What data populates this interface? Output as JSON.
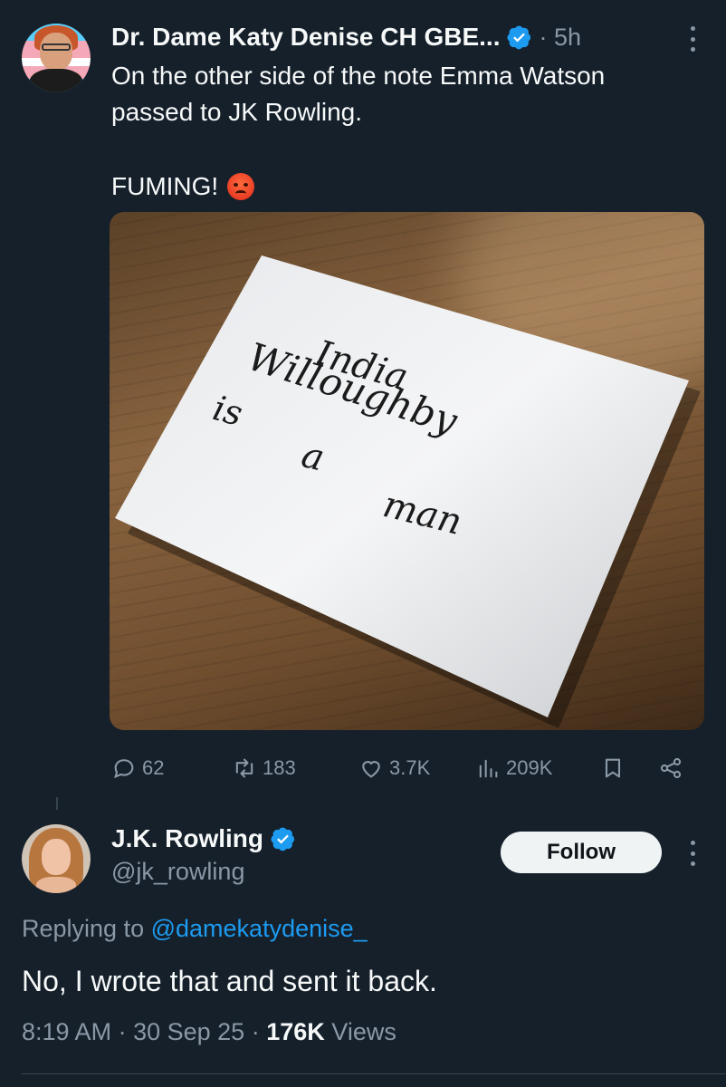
{
  "tweet": {
    "author_name": "Dr. Dame Katy Denise CH GBE...",
    "timestamp": "· 5h",
    "text_line1": "On the other side of the note Emma Watson",
    "text_line2": "passed to JK Rowling.",
    "text_line3": "FUMING!",
    "emoji": "angry-face",
    "image": {
      "note_line1": "India",
      "note_line2": "Willoughby",
      "note_line3": "is",
      "note_line4": "a",
      "note_line5": "man"
    },
    "actions": {
      "replies": "62",
      "reposts": "183",
      "likes": "3.7K",
      "views": "209K"
    }
  },
  "reply": {
    "author_name": "J.K. Rowling",
    "handle": "@jk_rowling",
    "follow_label": "Follow",
    "replying_prefix": "Replying to",
    "replying_mention": "@damekatydenise_",
    "text": "No, I wrote that and sent it back.",
    "time": "8:19 AM",
    "date": "30 Sep 25",
    "views_count": "176K",
    "views_label": "Views",
    "separator": "·"
  },
  "colors": {
    "background": "#15202b",
    "verified": "#1d9bf0",
    "muted": "#8b98a5",
    "link": "#1d9bf0"
  }
}
